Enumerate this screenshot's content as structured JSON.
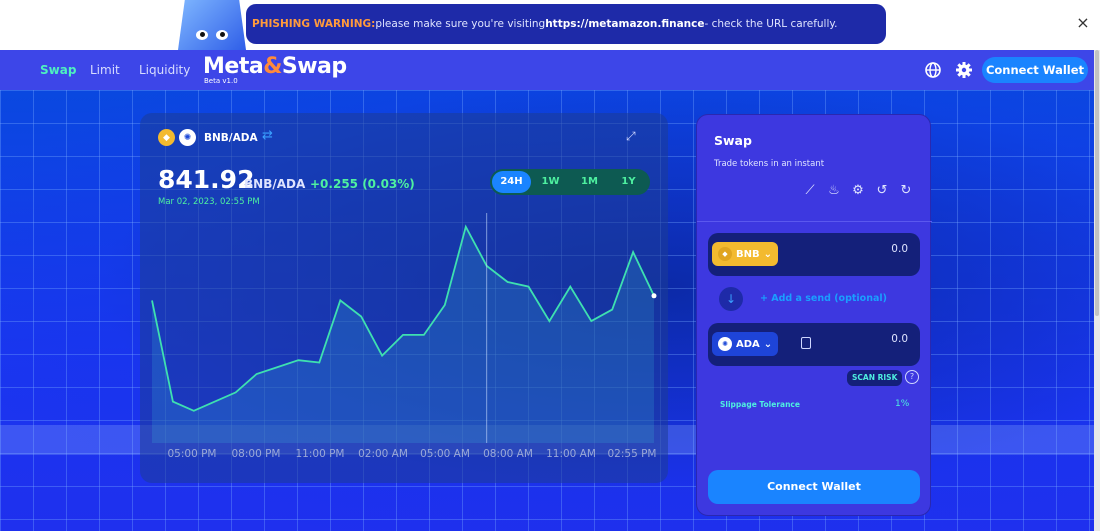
{
  "warning": {
    "label": "PHISHING WARNING:",
    "text": " please make sure you're visiting ",
    "url": "https://metamazon.finance",
    "tail": " - check the URL carefully.",
    "close_icon": "×"
  },
  "nav": {
    "links": [
      "Swap",
      "Limit",
      "Liquidity"
    ],
    "logo_main": "Meta",
    "logo_amp": "&",
    "logo_end": "Swap",
    "logo_version": "Beta v1.0",
    "connect": "Connect Wallet"
  },
  "chart": {
    "pair": "BNB/ADA",
    "price": "841.92",
    "price_pair": "BNB/ADA",
    "change": "+0.255 (0.03%)",
    "date": "Mar 02, 2023, 02:55 PM",
    "ranges": [
      "24H",
      "1W",
      "1M",
      "1Y"
    ],
    "active_range": "24H"
  },
  "chart_data": {
    "type": "area",
    "x": [
      "05:00 PM",
      "08:00 PM",
      "11:00 PM",
      "02:00 AM",
      "05:00 AM",
      "08:00 AM",
      "11:00 AM",
      "02:55 PM"
    ],
    "points": [
      0.62,
      0.18,
      0.14,
      0.18,
      0.22,
      0.3,
      0.33,
      0.36,
      0.35,
      0.62,
      0.55,
      0.38,
      0.47,
      0.47,
      0.6,
      0.94,
      0.77,
      0.7,
      0.68,
      0.53,
      0.68,
      0.53,
      0.58,
      0.83,
      0.64
    ],
    "hover_index": 16,
    "line_color": "#3ee0b0"
  },
  "swap": {
    "title": "Swap",
    "subtitle": "Trade tokens in an instant",
    "from_token": "BNB",
    "from_amount": "0.0",
    "add_send": "+ Add a send (optional)",
    "to_token": "ADA",
    "to_amount": "0.0",
    "scan_risk": "SCAN RISK",
    "slippage_label": "Slippage Tolerance",
    "slippage_value": "1%",
    "connect": "Connect Wallet"
  }
}
